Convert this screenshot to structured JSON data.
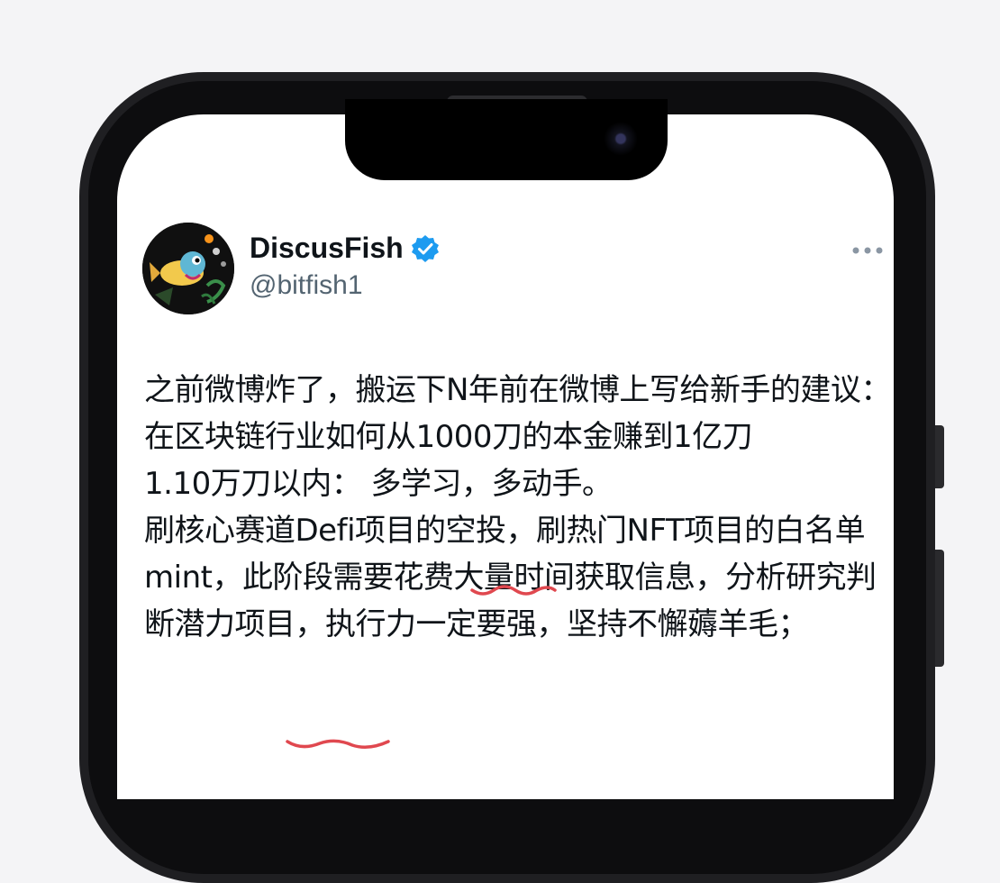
{
  "tweet": {
    "display_name": "DiscusFish",
    "handle": "@bitfish1",
    "text": "之前微博炸了，搬运下N年前在微博上写给新手的建议：在区块链行业如何从1000刀的本金赚到1亿刀\n1.10万刀以内： 多学习，多动手。\n刷核心赛道Defi项目的空投，刷热门NFT项目的白名单mint，此阶段需要花费大量时间获取信息，分析研究判断潜力项目，执行力一定要强，坚持不懈薅羊毛；"
  },
  "icons": {
    "verified": "verified-badge-icon",
    "more": "more-options-icon",
    "camera": "front-camera-icon"
  },
  "colors": {
    "verified_blue": "#1d9bf0",
    "underline_red": "#e0484f",
    "text_primary": "#0f1419",
    "text_secondary": "#536471"
  }
}
